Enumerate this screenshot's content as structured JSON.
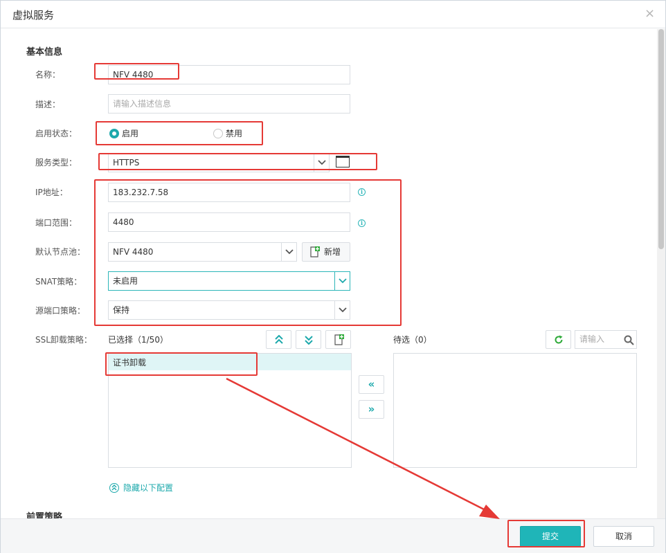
{
  "dialog": {
    "title": "虚拟服务",
    "close": "×"
  },
  "basic": {
    "section_title": "基本信息",
    "name_label": "名称：",
    "name_value": "NFV 4480",
    "desc_label": "描述：",
    "desc_placeholder": "请输入描述信息",
    "status_label": "启用状态：",
    "status_enable": "启用",
    "status_disable": "禁用",
    "service_type_label": "服务类型：",
    "service_type_value": "HTTPS",
    "ip_label": "IP地址：",
    "ip_value": "183.232.7.58",
    "port_label": "端口范围：",
    "port_value": "4480",
    "pool_label": "默认节点池：",
    "pool_value": "NFV 4480",
    "add_button": "新增",
    "snat_label": "SNAT策略：",
    "snat_value": "未启用",
    "source_port_label": "源端口策略：",
    "source_port_value": "保持",
    "ssl_label": "SSL卸载策略：",
    "selected_title": "已选择（1/50）",
    "selected_items": [
      "证书卸载"
    ],
    "pending_title": "待选（0）",
    "search_placeholder": "请输入",
    "hide_config": "隐藏以下配置",
    "pre_policy_title": "前置策略"
  },
  "footer": {
    "submit": "提交",
    "cancel": "取消"
  },
  "colors": {
    "accent": "#1fb5b8",
    "annotation": "#e53935"
  }
}
